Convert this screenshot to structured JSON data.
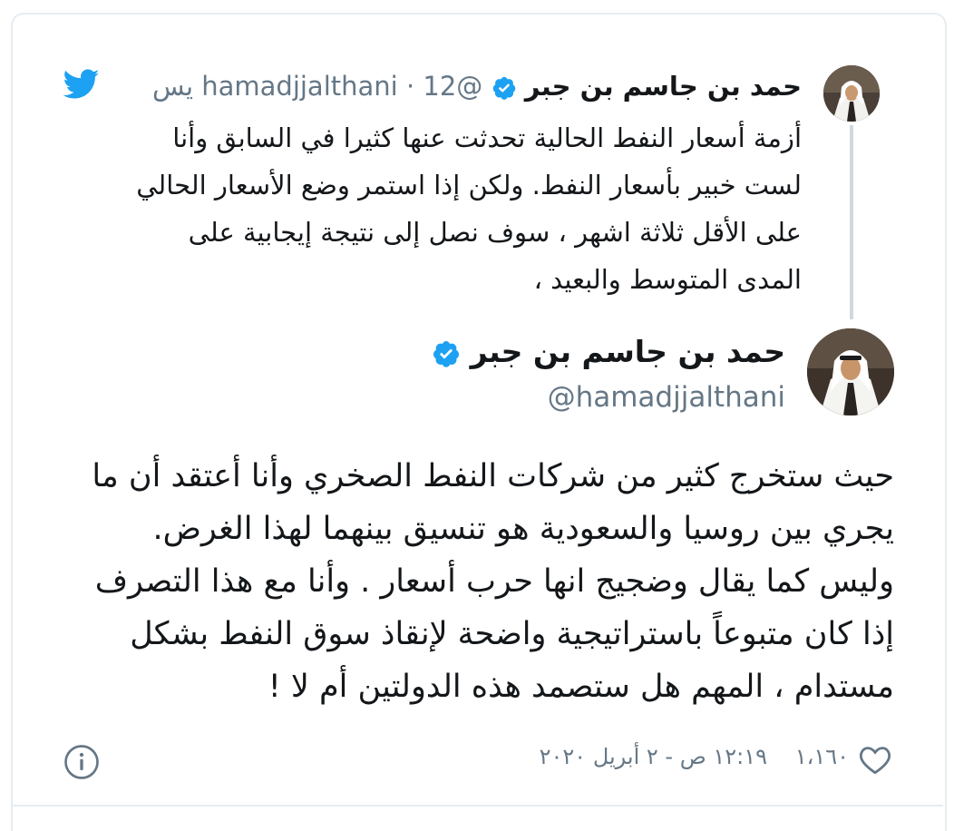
{
  "brand": {
    "bird_color": "#1da1f2",
    "verified_color": "#1da1f2"
  },
  "quoted_tweet": {
    "name": "حمد بن جاسم بن جبر",
    "handle": "@hamadjjalthani",
    "separator": "·",
    "time": "12 يس",
    "lines": [
      "أزمة أسعار النفط الحالية تحدثت عنها كثيرا في السابق وأنا",
      "لست خبير بأسعار النفط. ولكن  إذا استمر وضع الأسعار الحالي",
      "على الأقل ثلاثة اشهر ، سوف نصل إلى نتيجة إيجابية على",
      "المدى المتوسط والبعيد ،"
    ]
  },
  "main_tweet": {
    "name": "حمد بن جاسم بن جبر",
    "handle": "@hamadjjalthani",
    "lines": [
      "حيث ستخرج كثير من شركات النفط الصخري وأنا أعتقد أن ما",
      "يجري بين روسيا والسعودية هو تنسيق بينهما لهذا الغرض.",
      "وليس كما يقال وضجيج انها حرب أسعار . وأنا مع هذا التصرف",
      "إذا كان متبوعاً باستراتيجية واضحة لإنقاذ سوق النفط بشكل",
      "مستدام ، المهم هل ستصمد هذه الدولتين أم لا !"
    ],
    "footer": {
      "likes": "١،١٦٠",
      "timestamp": "١٢:١٩ ص - ٢ أبريل ٢٠٢٠"
    }
  },
  "icons": {
    "bird": "twitter-bird-icon",
    "verified": "verified-badge-icon",
    "heart": "heart-icon",
    "info": "info-icon"
  }
}
